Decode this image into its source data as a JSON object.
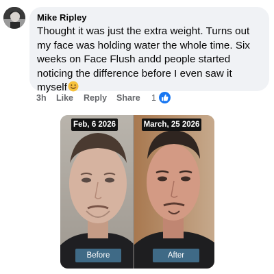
{
  "comment": {
    "author": "Mike Ripley",
    "text": "Thought it was just the extra weight. Turns out my face was holding water the whole time. Six weeks on Face Flush andd people started noticing the difference before I even saw it myself",
    "emoji_icon": "smiling-face-emoji",
    "avatar_icon": "profile-avatar"
  },
  "actions": {
    "time": "3h",
    "like": "Like",
    "reply": "Reply",
    "share": "Share",
    "reaction_count": "1",
    "reaction_icon": "like-thumbs-up-icon"
  },
  "image": {
    "before_date": "Feb, 6 2026",
    "after_date": "March, 25 2026",
    "before_label": "Before",
    "after_label": "After"
  },
  "colors": {
    "bubble": "#f0f2f5",
    "like_blue": "#1877f2",
    "label_blue": "#3f6a86",
    "date_bg": "#121212"
  }
}
